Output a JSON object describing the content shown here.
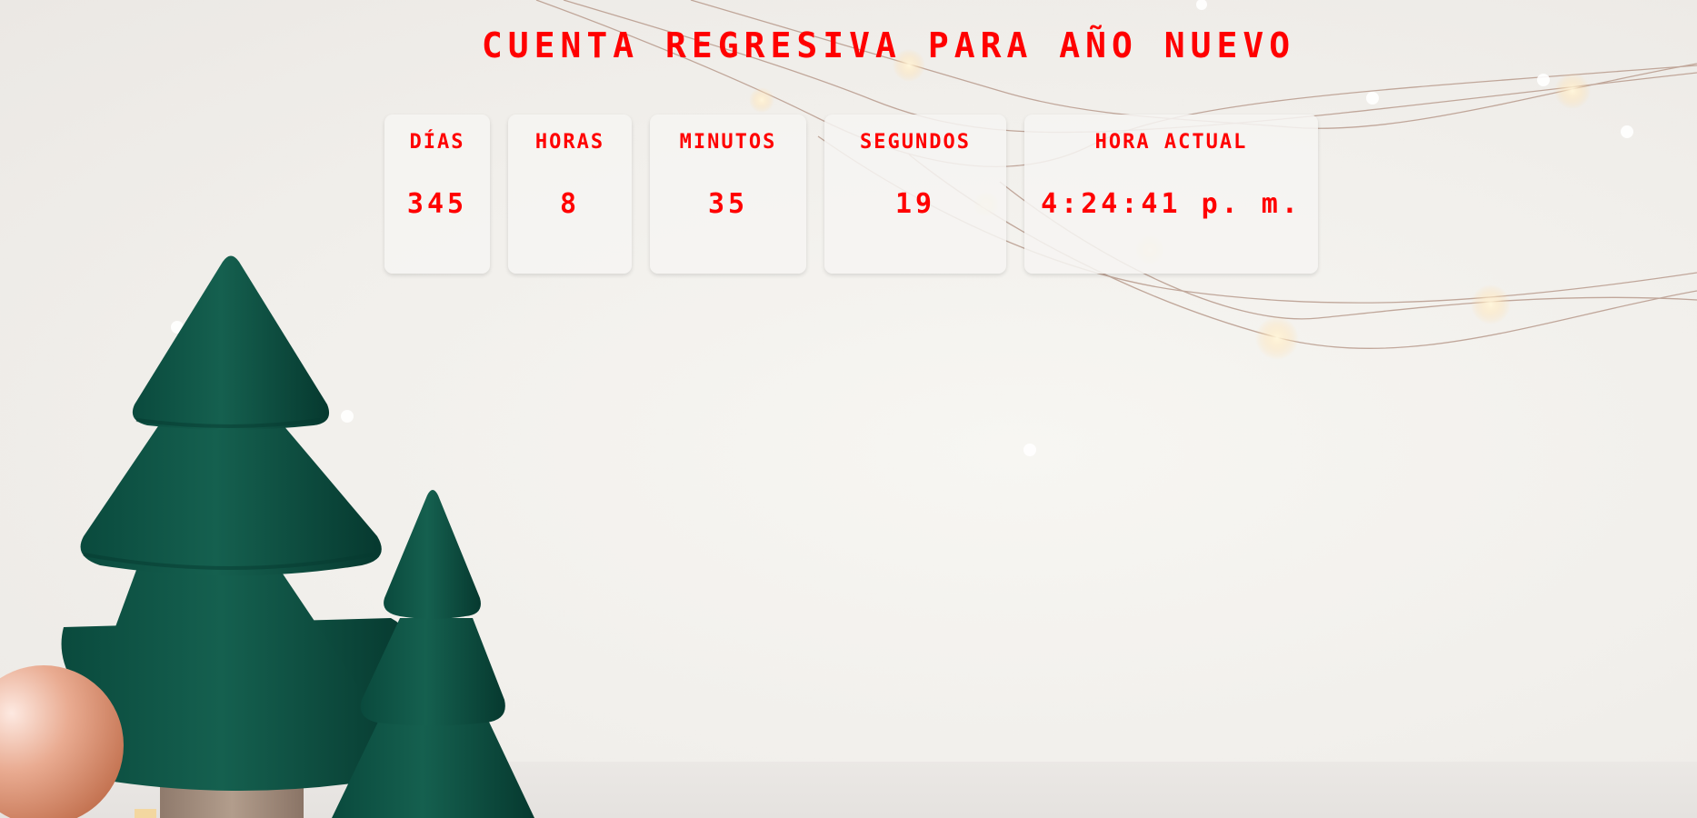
{
  "page": {
    "title": "Cuenta regresiva para Año Nuevo"
  },
  "countdown": {
    "days": {
      "label": "Días",
      "value": "345"
    },
    "hours": {
      "label": "Horas",
      "value": "8"
    },
    "minutes": {
      "label": "Minutos",
      "value": "35"
    },
    "seconds": {
      "label": "Segundos",
      "value": "19"
    }
  },
  "clock": {
    "label": "Hora actual",
    "value": "4:24:41 p. m."
  },
  "theme": {
    "accent": "#ff0000",
    "tree": "#0e5446",
    "ornament": "#d9957a",
    "background": "#f1efeb"
  },
  "decorations": {
    "trees": "christmas-tree-icon",
    "ornament": "ornament-ball-icon",
    "lights": "string-lights-icon"
  }
}
